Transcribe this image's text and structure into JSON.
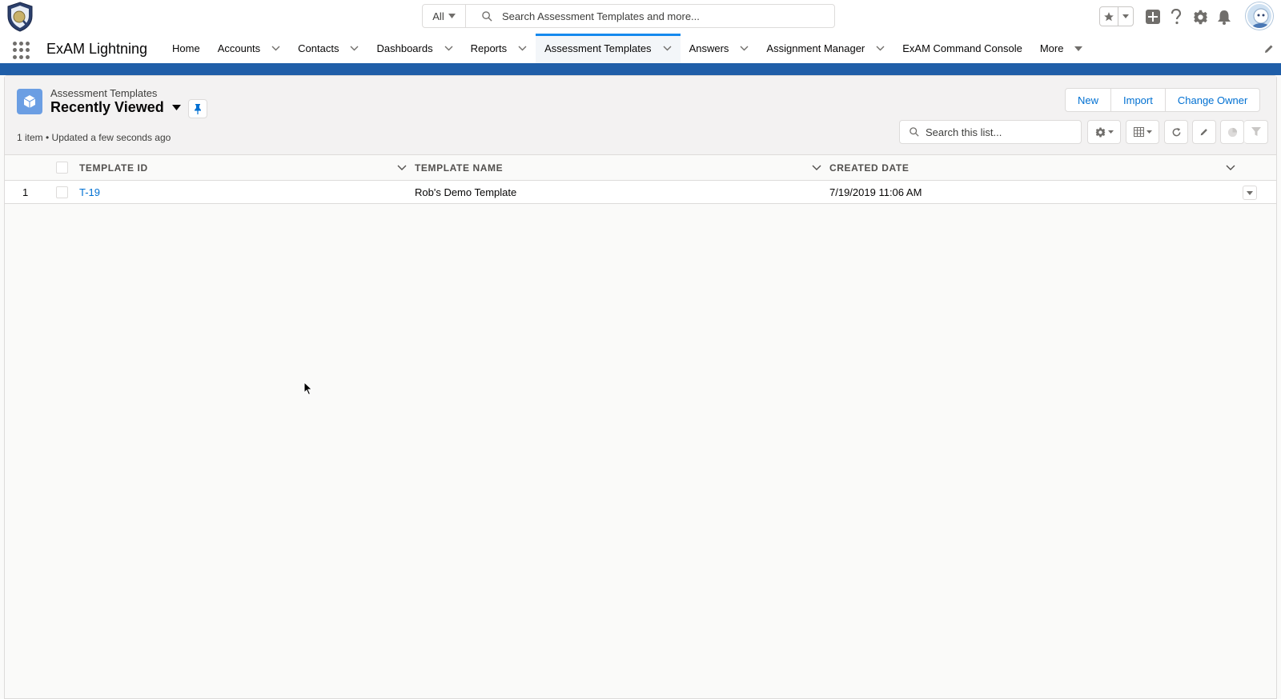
{
  "global_header": {
    "search_scope": "All",
    "search_placeholder": "Search Assessment Templates and more..."
  },
  "nav": {
    "app_name": "ExAM Lightning",
    "items": [
      {
        "label": "Home",
        "has_menu": false,
        "active": false
      },
      {
        "label": "Accounts",
        "has_menu": true,
        "active": false
      },
      {
        "label": "Contacts",
        "has_menu": true,
        "active": false
      },
      {
        "label": "Dashboards",
        "has_menu": true,
        "active": false
      },
      {
        "label": "Reports",
        "has_menu": true,
        "active": false
      },
      {
        "label": "Assessment Templates",
        "has_menu": true,
        "active": true
      },
      {
        "label": "Answers",
        "has_menu": true,
        "active": false
      },
      {
        "label": "Assignment Manager",
        "has_menu": true,
        "active": false
      },
      {
        "label": "ExAM Command Console",
        "has_menu": false,
        "active": false
      },
      {
        "label": "More",
        "has_menu": true,
        "active": false
      }
    ]
  },
  "list_view": {
    "object_label": "Assessment Templates",
    "title": "Recently Viewed",
    "meta": "1 item • Updated a few seconds ago",
    "buttons": {
      "new": "New",
      "import": "Import",
      "change_owner": "Change Owner"
    },
    "search_placeholder": "Search this list..."
  },
  "table": {
    "columns": [
      "TEMPLATE ID",
      "TEMPLATE NAME",
      "CREATED DATE"
    ],
    "rows": [
      {
        "num": "1",
        "template_id": "T-19",
        "template_name": "Rob's Demo Template",
        "created_date": "7/19/2019 11:06 AM"
      }
    ]
  },
  "colors": {
    "brand": "#1f5ea8",
    "link": "#0070d2",
    "active_tab": "#1589ee",
    "object_icon": "#6b9ee3"
  }
}
